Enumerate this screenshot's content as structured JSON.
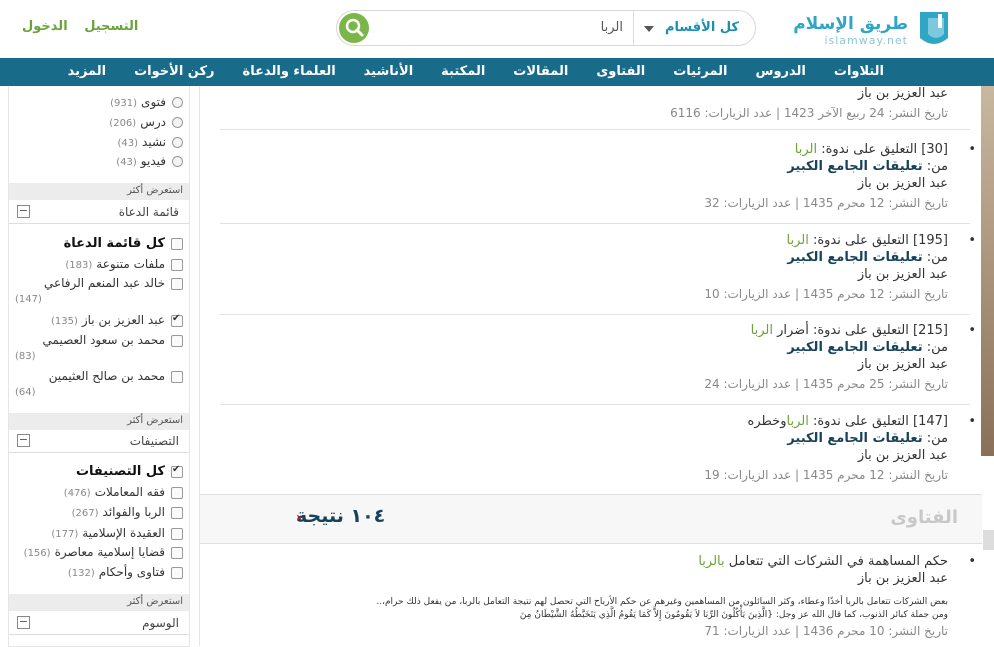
{
  "header": {
    "logo_ar": "طريق الإسلام",
    "logo_en": "islamway.net",
    "search_category": "كل الأقسام",
    "search_value": "الربا",
    "register": "التسجيل",
    "login": "الدخول"
  },
  "nav": {
    "items": [
      "التلاوات",
      "الدروس",
      "المرئيات",
      "الفتاوى",
      "المقالات",
      "المكتبة",
      "الأناشيد",
      "العلماء والدعاة",
      "ركن الأخوات",
      "المزيد"
    ]
  },
  "sidebar": {
    "types": [
      {
        "label": "فتوى",
        "count": "(931)"
      },
      {
        "label": "درس",
        "count": "(206)"
      },
      {
        "label": "نشيد",
        "count": "(43)"
      },
      {
        "label": "فيديو",
        "count": "(43)"
      }
    ],
    "show_more": "استعرض أكثر",
    "speakers_title": "قائمة الدعاة",
    "speakers": [
      {
        "label": "كل قائمة الدعاة",
        "count": "",
        "checked": false,
        "bold": true
      },
      {
        "label": "ملفات متنوعة",
        "count": "(183)",
        "checked": false
      },
      {
        "label": "خالد عبد المنعم الرفاعي",
        "count": "(147)",
        "checked": false
      },
      {
        "label": "عبد العزيز بن باز",
        "count": "(135)",
        "checked": true
      },
      {
        "label": "محمد بن سعود العصيمي",
        "count": "(83)",
        "checked": false
      },
      {
        "label": "محمد بن صالح العثيمين",
        "count": "(64)",
        "checked": false
      }
    ],
    "categories_title": "التصنيفات",
    "categories": [
      {
        "label": "كل التصنيفات",
        "count": "",
        "checked": true,
        "bold": true
      },
      {
        "label": "فقه المعاملات",
        "count": "(476)"
      },
      {
        "label": "الربا والفوائد",
        "count": "(267)"
      },
      {
        "label": "العقيدة الإسلامية",
        "count": "(177)"
      },
      {
        "label": "قضايا إسلامية معاصرة",
        "count": "(156)"
      },
      {
        "label": "فتاوى وأحكام",
        "count": "(132)"
      }
    ],
    "tags_title": "الوسوم"
  },
  "results": {
    "top_author": "عبد العزيز بن باز",
    "top_meta": "تاريخ النشر: 24 ربيع الآخر 1423 | عدد الزيارات: 6116",
    "from_label": "من:",
    "items": [
      {
        "num": "[30]",
        "prefix": "التعليق على ندوة:",
        "keyword": "الربا",
        "suffix": "",
        "series": "تعليقات الجامع الكبير",
        "author": "عبد العزيز بن باز",
        "meta": "تاريخ النشر: 12 محرم 1435 | عدد الزيارات: 32"
      },
      {
        "num": "[195]",
        "prefix": "التعليق على ندوة:",
        "keyword": "الربا",
        "suffix": "",
        "series": "تعليقات الجامع الكبير",
        "author": "عبد العزيز بن باز",
        "meta": "تاريخ النشر: 12 محرم 1435 | عدد الزيارات: 10"
      },
      {
        "num": "[215]",
        "prefix": "التعليق على ندوة: أضرار",
        "keyword": "الربا",
        "suffix": "",
        "series": "تعليقات الجامع الكبير",
        "author": "عبد العزيز بن باز",
        "meta": "تاريخ النشر: 25 محرم 1435 | عدد الزيارات: 24"
      },
      {
        "num": "[147]",
        "prefix": "التعليق على ندوة:",
        "keyword": "الربا",
        "suffix": "وخطره",
        "series": "تعليقات الجامع الكبير",
        "author": "عبد العزيز بن باز",
        "meta": "تاريخ النشر: 12 محرم 1435 | عدد الزيارات: 19"
      }
    ]
  },
  "fatawa": {
    "title": "الفتاوى",
    "count": "١٠٤ نتيجة",
    "item": {
      "title": "حكم المساهمة في الشركات التي تتعامل",
      "keyword": "بالربا",
      "author": "عبد العزيز بن باز",
      "excerpt_1": "بعض الشركات تتعامل بالربا أخذًا وعطاء، وكثر السائلون من المساهمين وغيرهم عن حكم الأرباح التي تحصل لهم نتيجة التعامل بالربا، من يفعل ذلك حرام،..",
      "excerpt_2": "ومن جملة كبائر الذنوب، كما قال الله عز وجل: {الَّذِينَ يَأْكُلُونَ الرِّبَا لاَ يَقُومُونَ إِلاَّ كَمَا يَقُومُ الَّذِي يَتَخَبَّطُهُ الشَّيْطَانُ مِنَ",
      "meta": "تاريخ النشر: 10 محرم 1436 | عدد الزيارات: 71"
    }
  }
}
